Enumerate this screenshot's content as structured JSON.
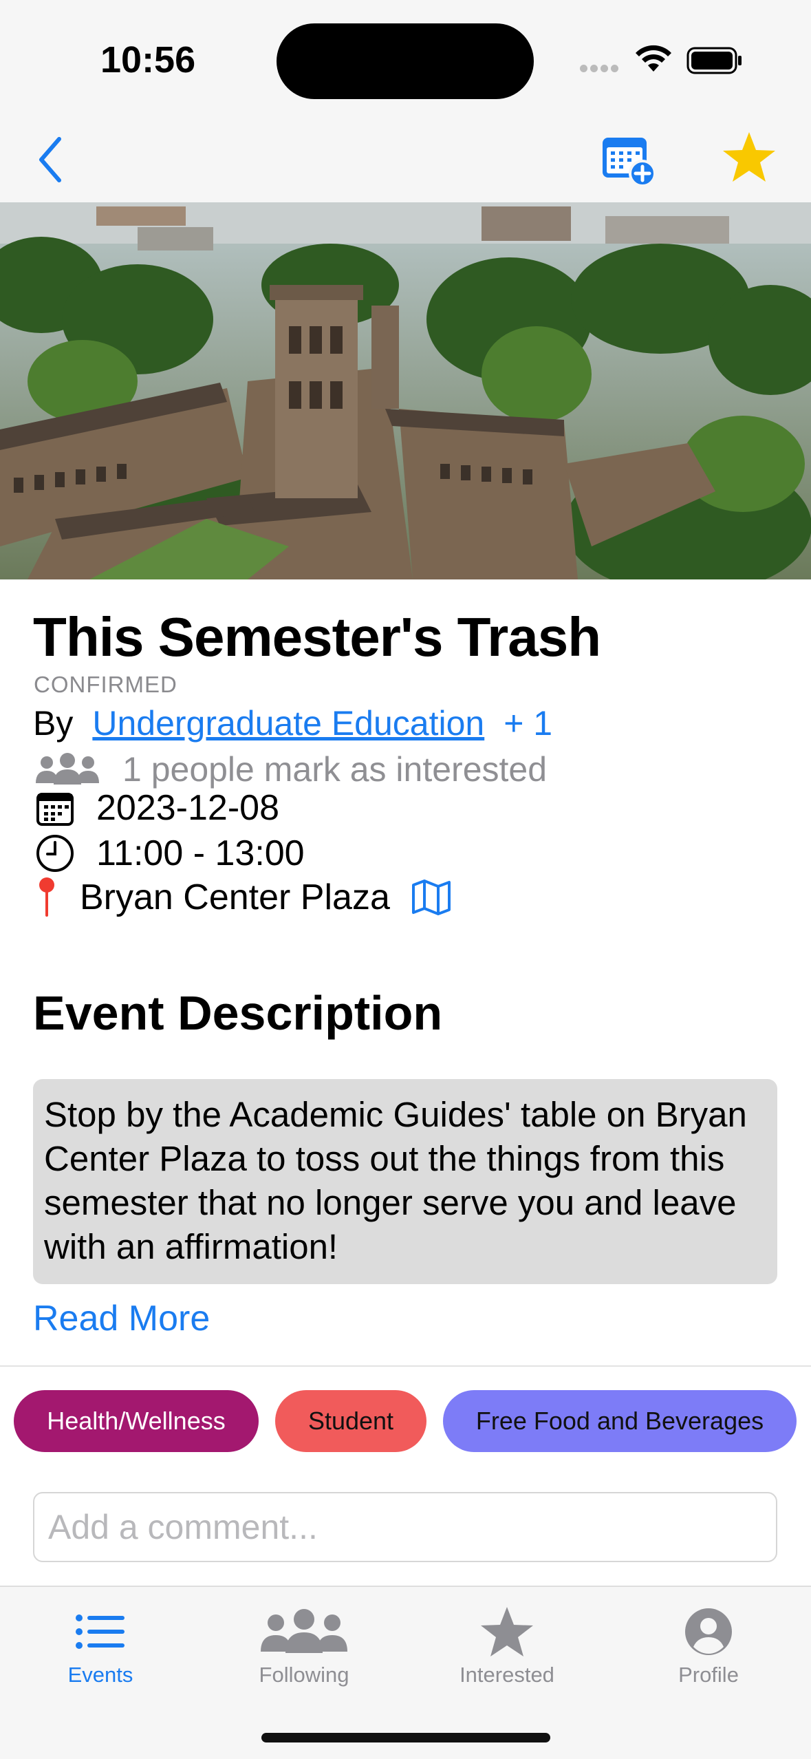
{
  "status": {
    "time": "10:56"
  },
  "event": {
    "title": "This Semester's Trash",
    "status": "CONFIRMED",
    "by_label": "By",
    "organizer": "Undergraduate Education",
    "organizer_extra": "+ 1",
    "interest": "1 people mark as interested",
    "date": "2023-12-08",
    "time": "11:00 - 13:00",
    "location": "Bryan Center Plaza"
  },
  "description": {
    "heading": "Event Description",
    "text": "Stop by the Academic Guides' table on Bryan Center Plaza to toss out the things from this semester that no longer serve you and leave with an affirmation!",
    "read_more": "Read More"
  },
  "tags": [
    "Health/Wellness",
    "Student",
    "Free Food and Beverages"
  ],
  "comment": {
    "placeholder": "Add a comment..."
  },
  "tabs": [
    {
      "label": "Events",
      "icon": "list-icon",
      "active": true
    },
    {
      "label": "Following",
      "icon": "people-icon",
      "active": false
    },
    {
      "label": "Interested",
      "icon": "star-icon",
      "active": false
    },
    {
      "label": "Profile",
      "icon": "person-circle-icon",
      "active": false
    }
  ],
  "colors": {
    "accent": "#1a7cf0",
    "star": "#f9c800",
    "tag_health": "#a3186f",
    "tag_student": "#f15b5b",
    "tag_food": "#7d7cf7"
  }
}
